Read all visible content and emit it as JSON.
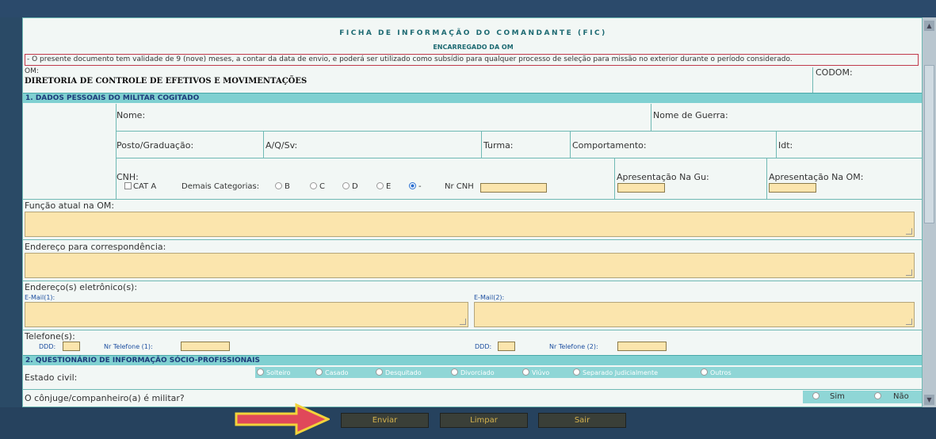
{
  "form": {
    "title": "FICHA DE INFORMAÇÃO DO COMANDANTE (FIC)",
    "subtitle": "ENCARREGADO DA OM",
    "notice": "- O presente documento tem validade de 9 (nove) meses, a contar da data de envio, e poderá ser utilizado como subsídio para qualquer processo de seleção para missão no exterior durante o período considerado.",
    "om_label": "OM:",
    "om_value": "DIRETORIA DE CONTROLE DE EFETIVOS E MOVIMENTAÇÕES",
    "codom_label": "CODOM:"
  },
  "section1": {
    "title": "1. DADOS PESSOAIS DO MILITAR COGITADO",
    "nome": "Nome:",
    "nome_guerra": "Nome de Guerra:",
    "posto": "Posto/Graduação:",
    "aqsv": "A/Q/Sv:",
    "turma": "Turma:",
    "comportamento": "Comportamento:",
    "idt": "Idt:",
    "cnh": "CNH:",
    "cat_a": "CAT A",
    "demais": "Demais Categorias:",
    "cat_b": "B",
    "cat_c": "C",
    "cat_d": "D",
    "cat_e": "E",
    "cat_none": "-",
    "nr_cnh": "Nr CNH",
    "apres_gu": "Apresentação Na Gu:",
    "apres_om": "Apresentação Na OM:",
    "funcao": "Função atual na OM:",
    "endereco": "Endereço para correspondência:",
    "emails": "Endereço(s) eletrônico(s):",
    "email1": "E-Mail(1):",
    "email2": "E-Mail(2):",
    "telefones": "Telefone(s):",
    "ddd": "DDD:",
    "tel1": "Nr Telefone (1):",
    "tel2": "Nr Telefone (2):"
  },
  "section2": {
    "title": "2. QUESTIONÁRIO DE INFORMAÇÃO SÓCIO-PROFISSIONAIS",
    "estado_civil": "Estado civil:",
    "options": [
      "Solteiro",
      "Casado",
      "Desquitado",
      "Divorciado",
      "Viúvo",
      "Separado Judicialmente",
      "Outros"
    ],
    "conjuge": "O cônjuge/companheiro(a) é militar?",
    "sim": "Sim",
    "nao": "Não"
  },
  "buttons": {
    "enviar": "Enviar",
    "limpar": "Limpar",
    "sair": "Sair"
  },
  "colors": {
    "section_bg": "#7fd0d1",
    "field_bg": "#fbe5ad",
    "button_text": "#d6b34e",
    "arrow": "#e0485a"
  }
}
